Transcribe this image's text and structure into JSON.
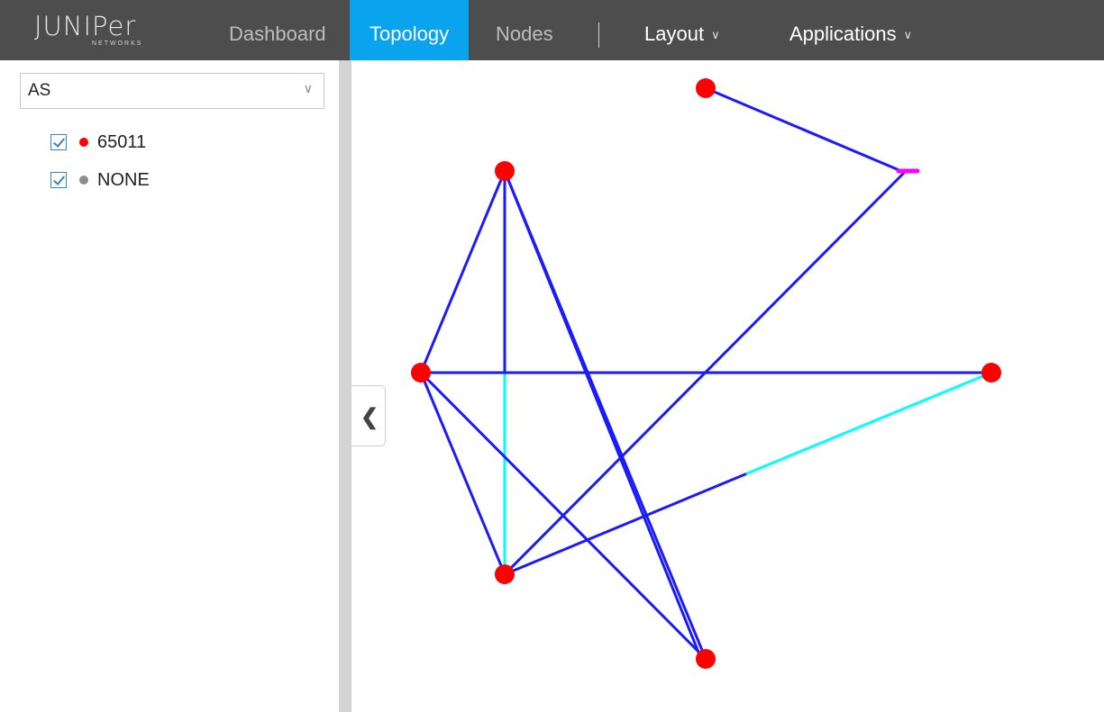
{
  "brand": {
    "logo_text": "JUNIPer",
    "logo_subtext": "NETWORKS"
  },
  "nav": {
    "dashboard": "Dashboard",
    "topology": "Topology",
    "nodes": "Nodes",
    "layout": "Layout",
    "applications": "Applications"
  },
  "sidebar": {
    "group_select_value": "AS",
    "legend": [
      {
        "label": "65011",
        "color": "#ff0000",
        "checked": true
      },
      {
        "label": "NONE",
        "color": "#8c8c8c",
        "checked": true
      }
    ]
  },
  "icons": {
    "dropdown": "chevron-down-icon",
    "collapse": "chevron-left-icon"
  },
  "colors": {
    "nav_bg": "#4d4d4d",
    "nav_active": "#0aa4ee",
    "node": "#ff0000",
    "link_up": "#1a1aff",
    "link_alt": "#00ffff",
    "link_marker": "#ff00ff"
  }
}
